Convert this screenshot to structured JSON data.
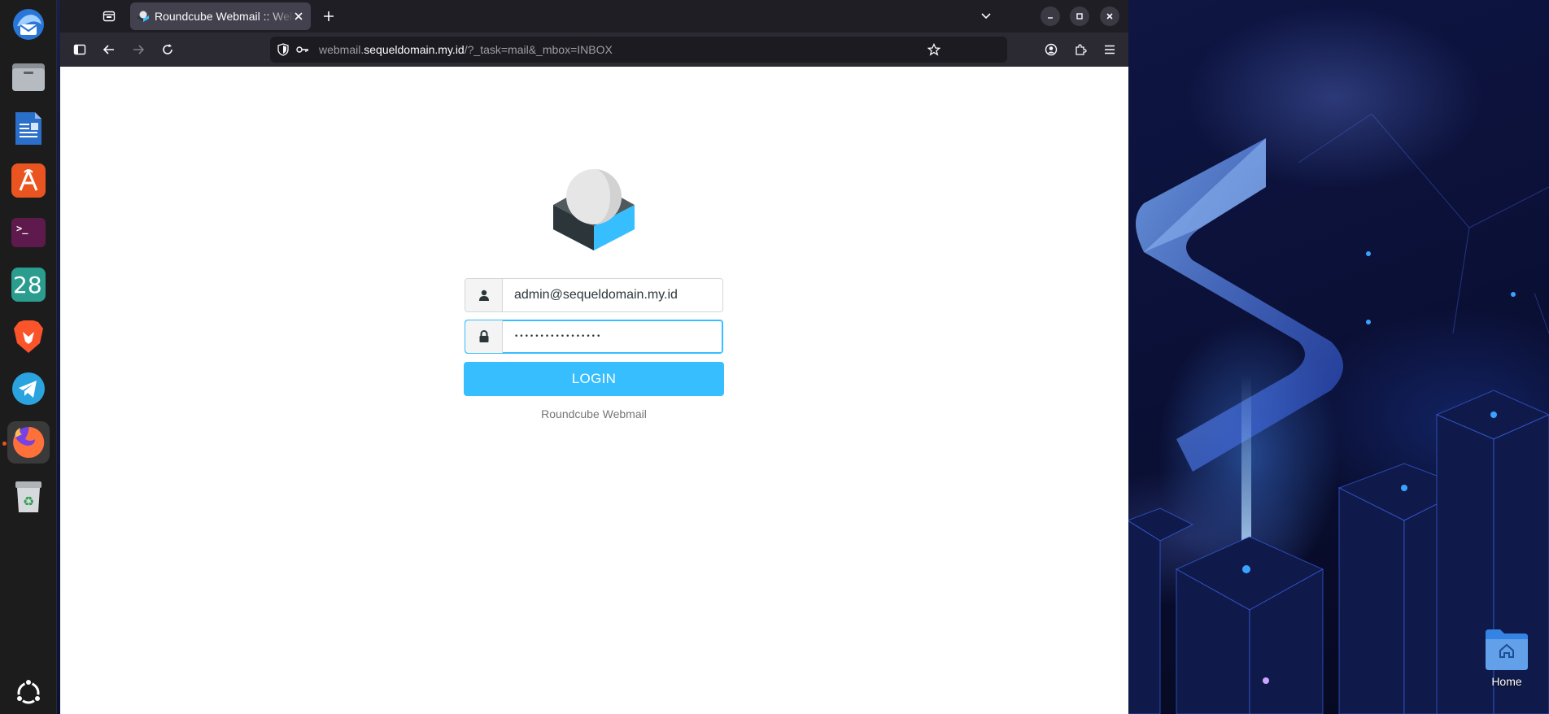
{
  "browser": {
    "tab": {
      "title": "Roundcube Webmail :: Welcome to Roundcube Webmail",
      "favicon": "roundcube-icon"
    },
    "url": {
      "domain_prefix": "webmail.",
      "domain": "sequeldomain.my.id",
      "path": "/?_task=mail&_mbox=INBOX"
    }
  },
  "login": {
    "username_value": "admin@sequeldomain.my.id",
    "password_mask": "•••••••••••••••••",
    "login_label": "LOGIN",
    "footer": "Roundcube Webmail",
    "accent_color": "#37beff"
  },
  "dock": {
    "apps": [
      "thunderbird-icon",
      "files-icon",
      "writer-icon",
      "app-center-icon",
      "terminal-icon",
      "calendar-icon",
      "brave-icon",
      "telegram-icon",
      "firefox-icon",
      "trash-icon",
      "show-apps-icon"
    ],
    "calendar_day": "28"
  },
  "desktop": {
    "home_label": "Home"
  }
}
